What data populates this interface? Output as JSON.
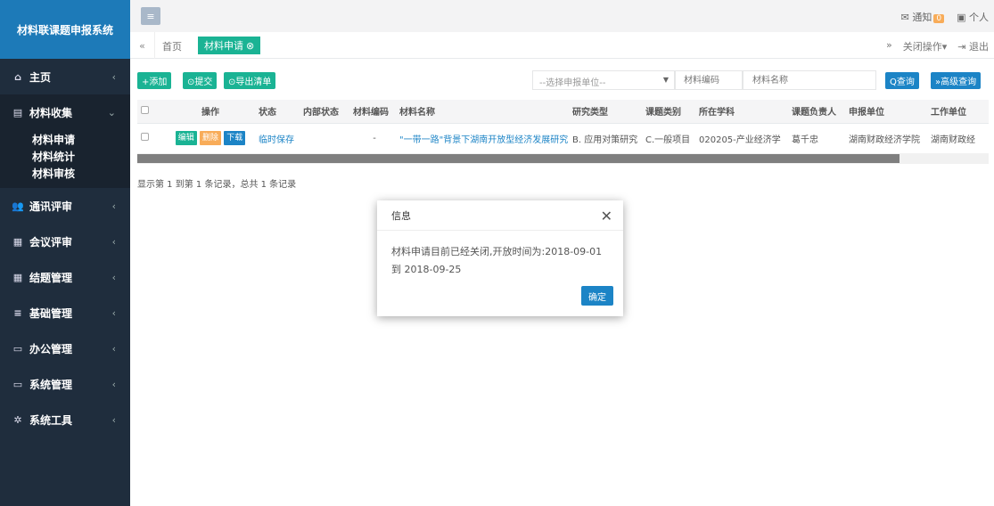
{
  "brand": "材料联课题申报系统",
  "sidebar": {
    "items": [
      {
        "label": "主页",
        "icon": "⌂",
        "chev": "‹"
      },
      {
        "label": "材料收集",
        "icon": "▤",
        "chev": "⌄"
      },
      {
        "label": "通讯评审",
        "icon": "👥",
        "chev": "‹"
      },
      {
        "label": "会议评审",
        "icon": "▦",
        "chev": "‹"
      },
      {
        "label": "结题管理",
        "icon": "▦",
        "chev": "‹"
      },
      {
        "label": "基础管理",
        "icon": "≡",
        "chev": "‹"
      },
      {
        "label": "办公管理",
        "icon": "▭",
        "chev": "‹"
      },
      {
        "label": "系统管理",
        "icon": "▭",
        "chev": "‹"
      },
      {
        "label": "系统工具",
        "icon": "✲",
        "chev": "‹"
      }
    ],
    "sub_items": [
      "材料申请",
      "材料统计",
      "材料审核"
    ]
  },
  "topbar": {
    "menu_icon": "≡",
    "notify_label": "通知",
    "notify_count": "0",
    "personal_label": "个人"
  },
  "tabs": {
    "back_icon": "«",
    "home": "首页",
    "active": "材料申请",
    "forward_icon": "»",
    "close_ops": "关闭操作▾",
    "logout": "退出"
  },
  "toolbar": {
    "add": "+添加",
    "submit": "⊙提交",
    "export": "⊙导出清单",
    "unit_placeholder": "--选择申报单位--",
    "code_placeholder": "材料编码",
    "name_placeholder": "材料名称",
    "query": "Q查询",
    "advanced": "»高级查询"
  },
  "table": {
    "headers": [
      "",
      "操作",
      "状态",
      "内部状态",
      "材料编码",
      "材料名称",
      "研究类型",
      "课题类别",
      "所在学科",
      "课题负责人",
      "申报单位",
      "工作单位"
    ],
    "row": {
      "edit": "编辑",
      "delete": "删除",
      "download": "下载",
      "status": "临时保存",
      "internal_status": "",
      "code": "-",
      "name": "\"一带一路\"背景下湖南开放型经济发展研究",
      "research_type": "B. 应用对策研究",
      "project_category": "C.一般项目",
      "discipline": "020205-产业经济学",
      "leader": "葛千忠",
      "unit": "湖南财政经济学院",
      "work_unit": "湖南财政经"
    }
  },
  "summary": "显示第 1 到第 1 条记录，总共 1 条记录",
  "modal": {
    "title": "信息",
    "message": "材料申请目前已经关闭,开放时间为:2018-09-01 到 2018-09-25",
    "ok": "确定"
  },
  "colors": {
    "sidebar_bg": "#1f2d3d",
    "brand_bg": "#1d7ab8",
    "primary_green": "#1ab394",
    "primary_blue": "#1c84c6",
    "warning_orange": "#f8ac59"
  }
}
